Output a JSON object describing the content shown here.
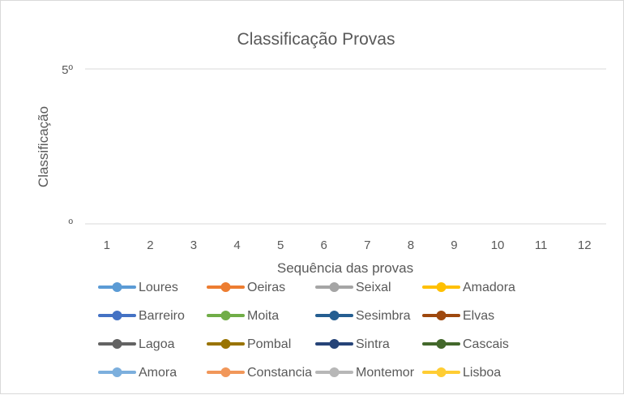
{
  "chart_data": {
    "type": "line",
    "title": "Classificação Provas",
    "xlabel": "Sequência das provas",
    "ylabel": "Classificação",
    "categories": [
      "1",
      "2",
      "3",
      "4",
      "5",
      "6",
      "7",
      "8",
      "9",
      "10",
      "11",
      "12"
    ],
    "y_tick_labels": [
      "5º",
      "º"
    ],
    "grid": true,
    "legend_position": "bottom",
    "series": [
      {
        "name": "Loures",
        "color": "#5B9BD5",
        "values": []
      },
      {
        "name": "Oeiras",
        "color": "#ED7D31",
        "values": []
      },
      {
        "name": "Seixal",
        "color": "#A5A5A5",
        "values": []
      },
      {
        "name": "Amadora",
        "color": "#FFC000",
        "values": []
      },
      {
        "name": "Barreiro",
        "color": "#4472C4",
        "values": []
      },
      {
        "name": "Moita",
        "color": "#70AD47",
        "values": []
      },
      {
        "name": "Sesimbra",
        "color": "#255E91",
        "values": []
      },
      {
        "name": "Elvas",
        "color": "#9E480E",
        "values": []
      },
      {
        "name": "Lagoa",
        "color": "#636363",
        "values": []
      },
      {
        "name": "Pombal",
        "color": "#997300",
        "values": []
      },
      {
        "name": "Sintra",
        "color": "#264478",
        "values": []
      },
      {
        "name": "Cascais",
        "color": "#43682B",
        "values": []
      },
      {
        "name": "Amora",
        "color": "#7CAFDD",
        "values": []
      },
      {
        "name": "Constancia",
        "color": "#F1975A",
        "values": []
      },
      {
        "name": "Montemor",
        "color": "#B7B7B7",
        "values": []
      },
      {
        "name": "Lisboa",
        "color": "#FFCD33",
        "values": []
      }
    ]
  }
}
